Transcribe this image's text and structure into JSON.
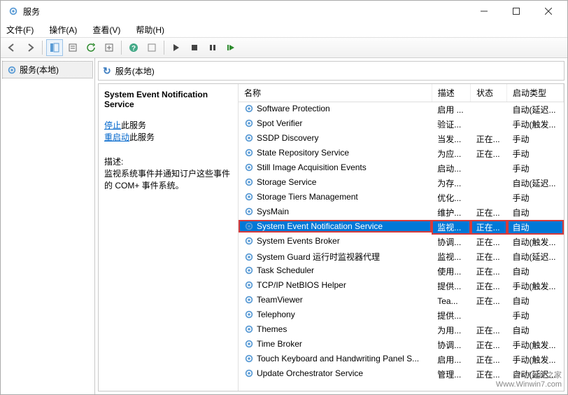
{
  "titlebar": {
    "title": "服务"
  },
  "menu": {
    "file": "文件(F)",
    "action": "操作(A)",
    "view": "查看(V)",
    "help": "帮助(H)"
  },
  "tree": {
    "root": "服务(本地)"
  },
  "header": {
    "title": "服务(本地)"
  },
  "detail": {
    "name": "System Event Notification Service",
    "stop_link": "停止",
    "stop_suffix": "此服务",
    "restart_link": "重启动",
    "restart_suffix": "此服务",
    "desc_label": "描述:",
    "desc": "监视系统事件并通知订户这些事件的 COM+ 事件系统。"
  },
  "columns": {
    "name": "名称",
    "description": "描述",
    "status": "状态",
    "startup": "启动类型"
  },
  "services": [
    {
      "name": "Software Protection",
      "desc": "启用 ...",
      "status": "",
      "startup": "自动(延迟..."
    },
    {
      "name": "Spot Verifier",
      "desc": "验证...",
      "status": "",
      "startup": "手动(触发..."
    },
    {
      "name": "SSDP Discovery",
      "desc": "当发...",
      "status": "正在...",
      "startup": "手动"
    },
    {
      "name": "State Repository Service",
      "desc": "为应...",
      "status": "正在...",
      "startup": "手动"
    },
    {
      "name": "Still Image Acquisition Events",
      "desc": "启动...",
      "status": "",
      "startup": "手动"
    },
    {
      "name": "Storage Service",
      "desc": "为存...",
      "status": "",
      "startup": "自动(延迟..."
    },
    {
      "name": "Storage Tiers Management",
      "desc": "优化...",
      "status": "",
      "startup": "手动"
    },
    {
      "name": "SysMain",
      "desc": "维护...",
      "status": "正在...",
      "startup": "自动"
    },
    {
      "name": "System Event Notification Service",
      "desc": "监视...",
      "status": "正在...",
      "startup": "自动",
      "selected": true,
      "highlight": true
    },
    {
      "name": "System Events Broker",
      "desc": "协调...",
      "status": "正在...",
      "startup": "自动(触发..."
    },
    {
      "name": "System Guard 运行时监视器代理",
      "desc": "监视...",
      "status": "正在...",
      "startup": "自动(延迟..."
    },
    {
      "name": "Task Scheduler",
      "desc": "使用...",
      "status": "正在...",
      "startup": "自动"
    },
    {
      "name": "TCP/IP NetBIOS Helper",
      "desc": "提供...",
      "status": "正在...",
      "startup": "手动(触发..."
    },
    {
      "name": "TeamViewer",
      "desc": "Tea...",
      "status": "正在...",
      "startup": "自动"
    },
    {
      "name": "Telephony",
      "desc": "提供...",
      "status": "",
      "startup": "手动"
    },
    {
      "name": "Themes",
      "desc": "为用...",
      "status": "正在...",
      "startup": "自动"
    },
    {
      "name": "Time Broker",
      "desc": "协调...",
      "status": "正在...",
      "startup": "手动(触发..."
    },
    {
      "name": "Touch Keyboard and Handwriting Panel S...",
      "desc": "启用...",
      "status": "正在...",
      "startup": "手动(触发..."
    },
    {
      "name": "Update Orchestrator Service",
      "desc": "管理...",
      "status": "正在...",
      "startup": "自动(延迟..."
    }
  ],
  "watermark": {
    "line1": "Win7系统之家",
    "line2": "Www.Winwin7.com"
  }
}
